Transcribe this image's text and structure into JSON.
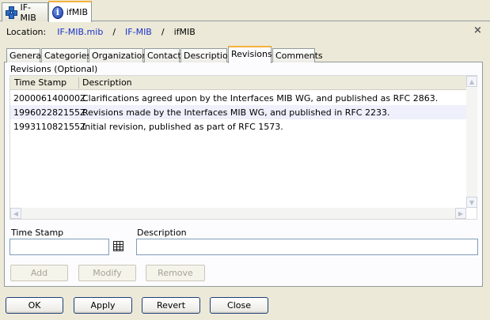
{
  "editor_tabs": [
    {
      "label": "IF-MIB",
      "icon": "mib-module-icon",
      "active": false
    },
    {
      "label": "ifMIB",
      "icon": "info-icon",
      "active": true
    }
  ],
  "location": {
    "label": "Location:",
    "crumbs": [
      "IF-MIB.mib",
      "IF-MIB",
      "ifMIB"
    ],
    "separator": "/"
  },
  "close_symbol": "×",
  "subtabs": [
    "General",
    "Categories",
    "Organization",
    "Contact",
    "Description",
    "Revisions",
    "Comments"
  ],
  "active_subtab": "Revisions",
  "revisions": {
    "section_label": "Revisions (Optional)",
    "columns": [
      "Time Stamp",
      "Description"
    ],
    "rows": [
      {
        "time_stamp": "200006140000Z",
        "description": "Clarifications agreed upon by the Interfaces MIB WG, and published as RFC 2863."
      },
      {
        "time_stamp": "199602282155Z",
        "description": "Revisions made by the Interfaces MIB WG, and published in RFC 2233."
      },
      {
        "time_stamp": "199311082155Z",
        "description": "Initial revision, published as part of RFC 1573."
      }
    ],
    "selected_row": 1
  },
  "form": {
    "time_stamp_label": "Time Stamp",
    "time_stamp_value": "",
    "description_label": "Description",
    "description_value": ""
  },
  "row_actions": {
    "add": "Add",
    "modify": "Modify",
    "remove": "Remove"
  },
  "dialog_buttons": {
    "ok": "OK",
    "apply": "Apply",
    "revert": "Revert",
    "close": "Close"
  },
  "colors": {
    "accent_tab": "#f5b13d",
    "link": "#1a33c8",
    "selected_row": "#eef0fb"
  }
}
